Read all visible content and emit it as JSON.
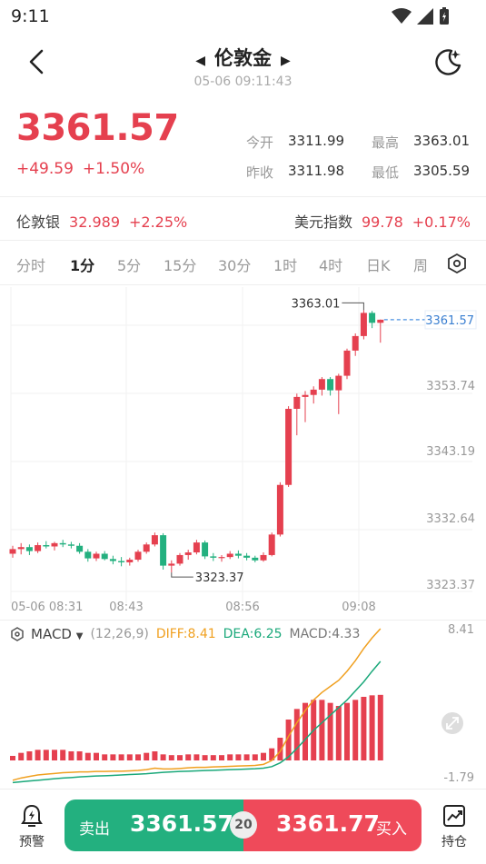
{
  "status_bar": {
    "time": "9:11"
  },
  "header": {
    "title": "伦敦金",
    "timestamp": "05-06 09:11:43"
  },
  "quote": {
    "price": "3361.57",
    "change": "+49.59",
    "change_pct": "+1.50%",
    "open_label": "今开",
    "open": "3311.99",
    "high_label": "最高",
    "high": "3363.01",
    "prev_close_label": "昨收",
    "prev_close": "3311.98",
    "low_label": "最低",
    "low": "3305.59"
  },
  "related": [
    {
      "name": "伦敦银",
      "price": "32.989",
      "change": "+2.25%"
    },
    {
      "name": "美元指数",
      "price": "99.78",
      "change": "+0.17%"
    }
  ],
  "tabs": [
    "分时",
    "1分",
    "5分",
    "15分",
    "30分",
    "1时",
    "4时",
    "日K",
    "周"
  ],
  "active_tab": "1分",
  "chart": {
    "y_labels": [
      "3353.74",
      "3343.19",
      "3332.64",
      "3323.37"
    ],
    "x_labels": [
      "05-06 08:31",
      "08:43",
      "08:56",
      "09:08"
    ],
    "high_marker": "3363.01",
    "low_marker": "3323.37",
    "current_price_tag": "3361.57",
    "up_color": "#e5404f",
    "down_color": "#23b07f"
  },
  "chart_data": {
    "type": "candlestick",
    "ylim": [
      3320.5,
      3366.5
    ],
    "candles": [
      [
        3326.2,
        3327.4,
        3325.6,
        3326.9
      ],
      [
        3326.9,
        3327.8,
        3326.1,
        3327.2
      ],
      [
        3327.2,
        3327.6,
        3326.0,
        3326.6
      ],
      [
        3326.6,
        3327.9,
        3326.3,
        3327.5
      ],
      [
        3327.5,
        3328.1,
        3327.0,
        3327.3
      ],
      [
        3327.3,
        3328.0,
        3326.7,
        3327.8
      ],
      [
        3327.8,
        3328.3,
        3327.2,
        3327.6
      ],
      [
        3327.6,
        3328.0,
        3327.0,
        3327.4
      ],
      [
        3327.4,
        3327.8,
        3326.2,
        3326.5
      ],
      [
        3326.5,
        3326.9,
        3325.0,
        3325.5
      ],
      [
        3325.5,
        3326.5,
        3325.1,
        3326.2
      ],
      [
        3326.2,
        3326.6,
        3325.2,
        3325.4
      ],
      [
        3325.4,
        3325.9,
        3324.6,
        3325.1
      ],
      [
        3325.1,
        3325.7,
        3324.3,
        3324.9
      ],
      [
        3324.9,
        3325.6,
        3324.4,
        3325.3
      ],
      [
        3325.3,
        3326.8,
        3325.0,
        3326.5
      ],
      [
        3326.5,
        3327.9,
        3326.2,
        3327.6
      ],
      [
        3327.6,
        3329.4,
        3327.3,
        3329.0
      ],
      [
        3329.0,
        3329.3,
        3323.8,
        3324.4
      ],
      [
        3324.4,
        3325.2,
        3323.37,
        3324.7
      ],
      [
        3324.7,
        3326.3,
        3324.4,
        3326.0
      ],
      [
        3326.0,
        3326.8,
        3325.3,
        3326.4
      ],
      [
        3326.4,
        3328.3,
        3326.1,
        3327.9
      ],
      [
        3327.9,
        3328.2,
        3325.4,
        3325.8
      ],
      [
        3325.8,
        3326.3,
        3325.1,
        3325.6
      ],
      [
        3325.6,
        3326.0,
        3325.0,
        3325.7
      ],
      [
        3325.7,
        3326.6,
        3325.4,
        3326.2
      ],
      [
        3326.2,
        3326.7,
        3325.5,
        3325.9
      ],
      [
        3325.9,
        3326.3,
        3325.2,
        3325.6
      ],
      [
        3325.6,
        3325.9,
        3324.9,
        3325.2
      ],
      [
        3325.2,
        3326.4,
        3325.0,
        3326.0
      ],
      [
        3326.0,
        3329.4,
        3325.8,
        3329.1
      ],
      [
        3329.1,
        3337.0,
        3328.8,
        3336.6
      ],
      [
        3336.6,
        3348.5,
        3336.3,
        3348.1
      ],
      [
        3348.1,
        3350.4,
        3344.1,
        3349.9
      ],
      [
        3349.9,
        3350.8,
        3346.1,
        3350.2
      ],
      [
        3350.2,
        3351.5,
        3348.9,
        3351.0
      ],
      [
        3351.0,
        3352.9,
        3350.1,
        3352.6
      ],
      [
        3352.6,
        3352.9,
        3350.1,
        3350.9
      ],
      [
        3350.9,
        3353.4,
        3347.3,
        3353.1
      ],
      [
        3353.1,
        3357.2,
        3352.6,
        3356.9
      ],
      [
        3356.9,
        3359.5,
        3356.1,
        3359.1
      ],
      [
        3359.1,
        3363.01,
        3358.6,
        3362.6
      ],
      [
        3362.6,
        3362.9,
        3360.3,
        3361.1
      ],
      [
        3361.1,
        3361.6,
        3358.1,
        3361.57
      ]
    ]
  },
  "macd": {
    "title": "MACD",
    "params": "(12,26,9)",
    "diff_label": "DIFF:8.41",
    "dea_label": "DEA:6.25",
    "macd_label": "MACD:4.33",
    "y_max": "8.41",
    "y_min": "-1.79",
    "diff_color": "#f0a020",
    "dea_color": "#1aa87a",
    "bar_color": "#e5404f",
    "ylim": [
      -1.79,
      8.41
    ],
    "diff": [
      -1.6,
      -1.45,
      -1.35,
      -1.25,
      -1.2,
      -1.15,
      -1.1,
      -1.08,
      -1.05,
      -1.05,
      -1.02,
      -1.02,
      -1.0,
      -1.0,
      -0.98,
      -0.95,
      -0.9,
      -0.8,
      -0.85,
      -0.85,
      -0.82,
      -0.78,
      -0.75,
      -0.75,
      -0.72,
      -0.7,
      -0.68,
      -0.66,
      -0.64,
      -0.62,
      -0.55,
      -0.3,
      0.3,
      1.3,
      2.2,
      3.0,
      3.7,
      4.2,
      4.6,
      5.0,
      5.6,
      6.3,
      7.1,
      7.8,
      8.41
    ],
    "dea": [
      -1.75,
      -1.7,
      -1.65,
      -1.6,
      -1.55,
      -1.5,
      -1.45,
      -1.42,
      -1.38,
      -1.35,
      -1.32,
      -1.3,
      -1.28,
      -1.25,
      -1.22,
      -1.2,
      -1.17,
      -1.12,
      -1.08,
      -1.05,
      -1.02,
      -1.0,
      -0.98,
      -0.96,
      -0.94,
      -0.92,
      -0.9,
      -0.88,
      -0.86,
      -0.84,
      -0.8,
      -0.7,
      -0.45,
      -0.05,
      0.5,
      1.1,
      1.7,
      2.2,
      2.7,
      3.2,
      3.7,
      4.3,
      4.9,
      5.6,
      6.25
    ],
    "hist": [
      0.3,
      0.5,
      0.6,
      0.7,
      0.7,
      0.7,
      0.7,
      0.6,
      0.6,
      0.5,
      0.5,
      0.4,
      0.4,
      0.4,
      0.4,
      0.4,
      0.5,
      0.6,
      0.4,
      0.35,
      0.35,
      0.4,
      0.4,
      0.35,
      0.35,
      0.35,
      0.4,
      0.4,
      0.4,
      0.4,
      0.5,
      0.8,
      1.5,
      2.7,
      3.4,
      3.8,
      4.0,
      4.0,
      3.8,
      3.6,
      3.8,
      4.0,
      4.2,
      4.3,
      4.33
    ]
  },
  "bottom_bar": {
    "alert_label": "预警",
    "sell_label": "卖出",
    "sell_price": "3361.57",
    "spread": "20",
    "buy_price": "3361.77",
    "buy_label": "买入",
    "position_label": "持仓"
  }
}
